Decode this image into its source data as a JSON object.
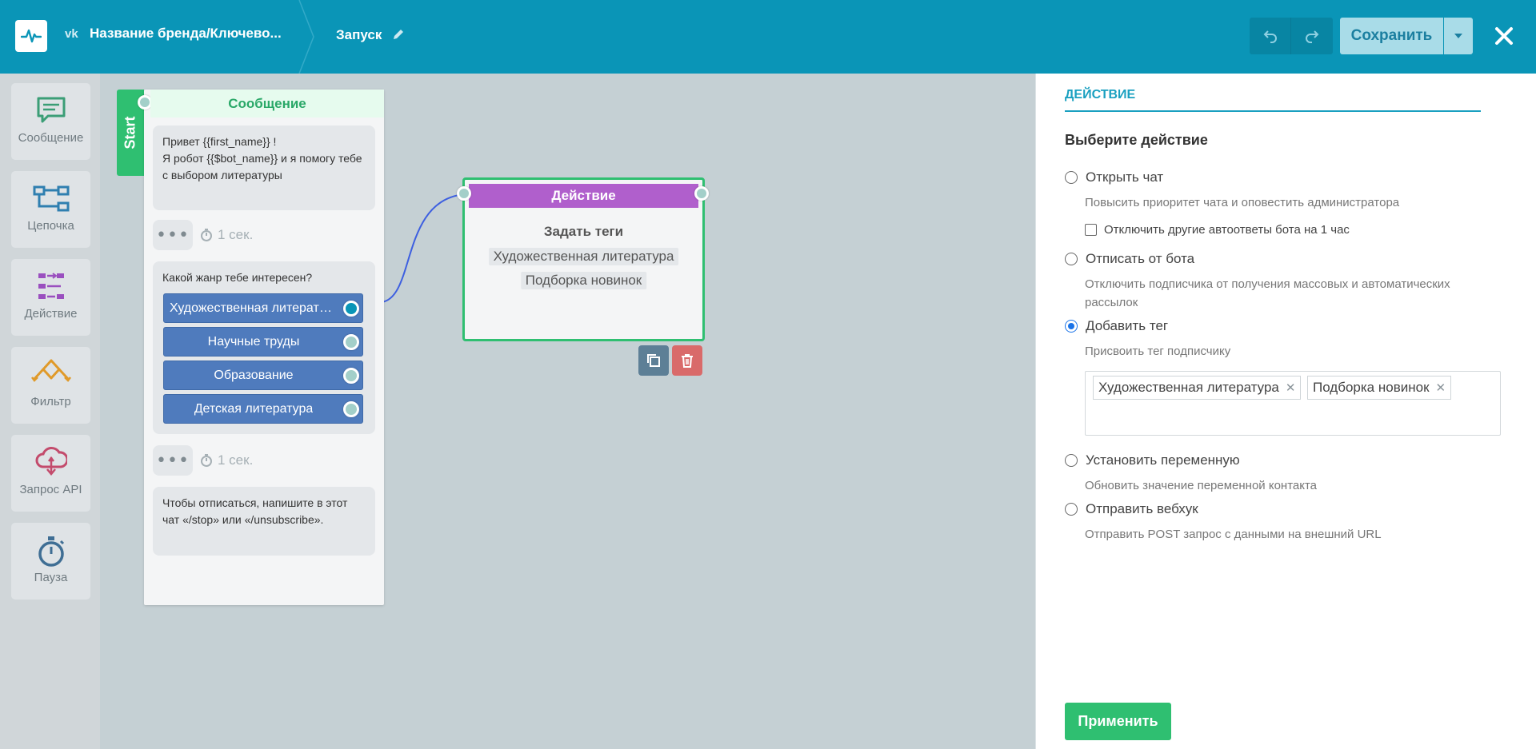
{
  "header": {
    "brand": "Название бренда/Ключево...",
    "flow_name": "Запуск",
    "save_label": "Сохранить"
  },
  "toolbar": {
    "items": [
      {
        "label": "Сообщение",
        "icon": "message-icon",
        "color": "#3b9e76"
      },
      {
        "label": "Цепочка",
        "icon": "chain-icon",
        "color": "#2f7fb0"
      },
      {
        "label": "Действие",
        "icon": "action-icon",
        "color": "#9a4fbf"
      },
      {
        "label": "Фильтр",
        "icon": "filter-icon",
        "color": "#e09a2a"
      },
      {
        "label": "Запрос API",
        "icon": "api-icon",
        "color": "#c34b6c"
      },
      {
        "label": "Пауза",
        "icon": "pause-icon",
        "color": "#3f6e94"
      }
    ]
  },
  "canvas": {
    "start_label": "Start",
    "message_node": {
      "title": "Сообщение",
      "bubble1": "Привет {{first_name}} !\nЯ робот  {{$bot_name}} и я помогу тебе с выбором литературы",
      "typing": "•••",
      "delay1": "1 сек.",
      "question": "Какой жанр тебе интересен?",
      "buttons": [
        "Художественная литература",
        "Научные труды",
        "Образование",
        "Детская литература"
      ],
      "delay2": "1 сек.",
      "bubble2": "Чтобы отписаться, напишите в этот чат «/stop» или «/unsubscribe»."
    },
    "action_node": {
      "title": "Действие",
      "subtitle": "Задать теги",
      "tags": [
        "Художественная литература",
        "Подборка новинок"
      ]
    }
  },
  "panel": {
    "tab": "ДЕЙСТВИЕ",
    "heading": "Выберите действие",
    "options": [
      {
        "label": "Открыть чат",
        "desc": "Повысить приоритет чата и оповестить администратора",
        "checked": false
      },
      {
        "label": "Отписать от бота",
        "desc": "Отключить подписчика от получения массовых и автоматических рассылок",
        "checked": false
      },
      {
        "label": "Добавить тег",
        "desc": "Присвоить тег подписчику",
        "checked": true
      },
      {
        "label": "Установить переменную",
        "desc": "Обновить значение переменной контакта",
        "checked": false
      },
      {
        "label": "Отправить вебхук",
        "desc": "Отправить POST запрос с данными на внешний URL",
        "checked": false
      }
    ],
    "checkbox_label": "Отключить другие автоответы бота на 1 час",
    "tags": [
      "Художественная литература",
      "Подборка новинок"
    ],
    "apply_label": "Применить"
  },
  "colors": {
    "header": "#0a95b7",
    "green": "#2fbf71",
    "action_purple": "#b05fcc",
    "quick_reply_blue": "#4f7bbd"
  }
}
